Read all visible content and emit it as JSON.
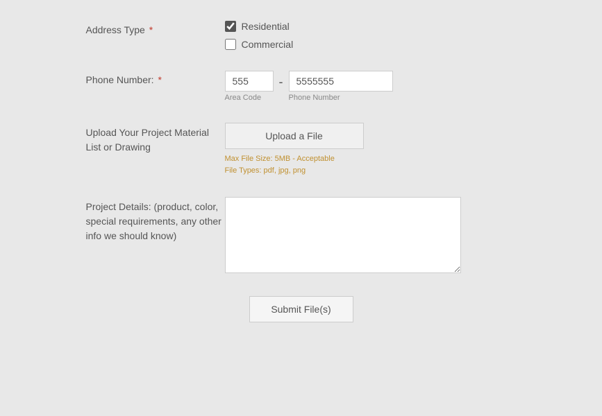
{
  "form": {
    "addressType": {
      "label": "Address Type",
      "required": true,
      "options": [
        {
          "label": "Residential",
          "checked": true
        },
        {
          "label": "Commercial",
          "checked": false
        }
      ]
    },
    "phoneNumber": {
      "label": "Phone Number:",
      "required": true,
      "areaCode": {
        "value": "555",
        "sublabel": "Area Code"
      },
      "dash": "-",
      "number": {
        "value": "5555555",
        "sublabel": "Phone Number"
      }
    },
    "upload": {
      "label": "Upload Your Project Material List or Drawing",
      "buttonLabel": "Upload a File",
      "infoLine1": "Max File Size: 5MB - Acceptable",
      "infoLine2": "File Types: pdf, jpg, png"
    },
    "projectDetails": {
      "label": "Project Details: (product, color, special requirements, any other info we should know)"
    },
    "submit": {
      "label": "Submit File(s)"
    }
  }
}
